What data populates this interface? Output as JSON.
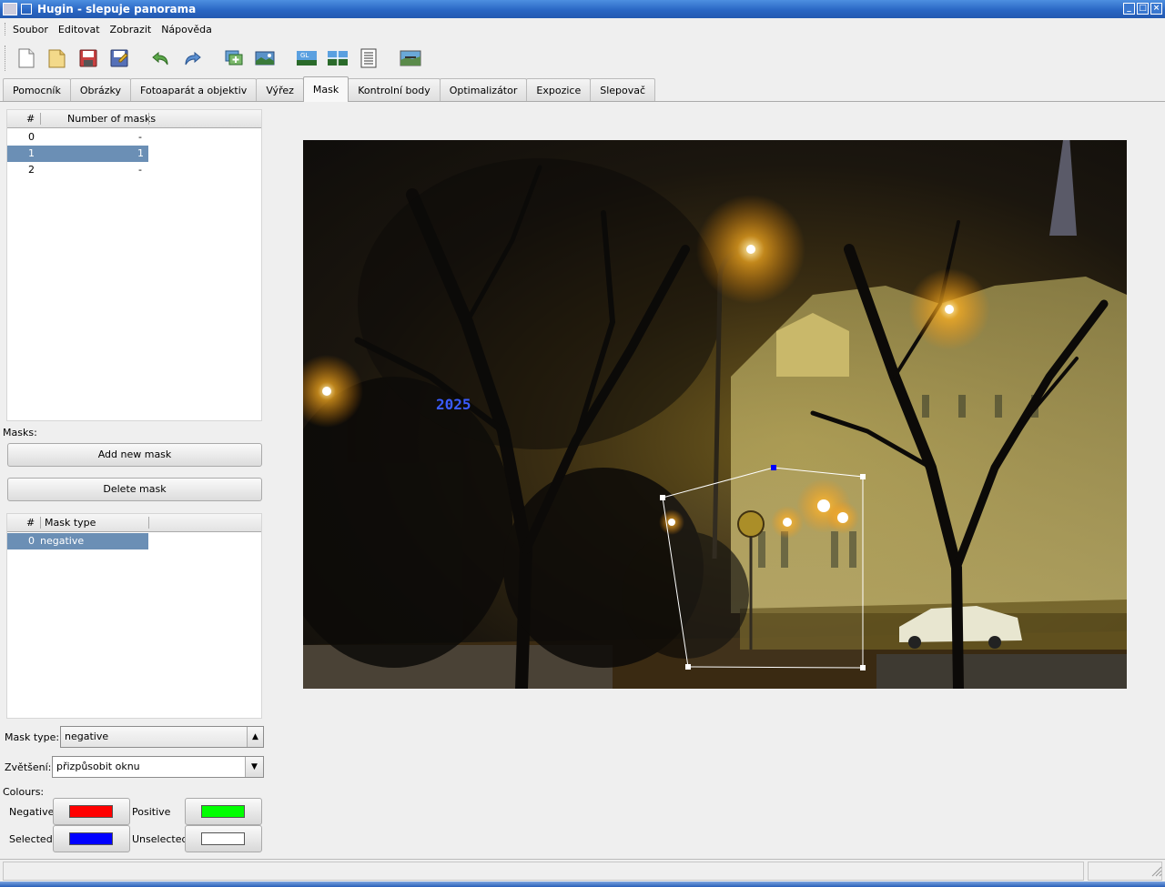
{
  "window": {
    "title": "Hugin - slepuje panorama"
  },
  "menu": {
    "items": [
      "Soubor",
      "Editovat",
      "Zobrazit",
      "Nápověda"
    ]
  },
  "toolbar": {
    "icons": [
      "new-project-icon",
      "open-project-icon",
      "save-icon",
      "save-as-icon",
      "undo-icon",
      "redo-icon",
      "add-images-icon",
      "assistant-icon",
      "gl-preview-icon",
      "fast-preview-icon",
      "properties-icon",
      "panorama-preview-icon"
    ]
  },
  "tabs": [
    {
      "label": "Pomocník",
      "active": false
    },
    {
      "label": "Obrázky",
      "active": false
    },
    {
      "label": "Fotoaparát a objektiv",
      "active": false
    },
    {
      "label": "Výřez",
      "active": false
    },
    {
      "label": "Mask",
      "active": true
    },
    {
      "label": "Kontrolní body",
      "active": false
    },
    {
      "label": "Optimalizátor",
      "active": false
    },
    {
      "label": "Expozice",
      "active": false
    },
    {
      "label": "Slepovač",
      "active": false
    }
  ],
  "images_list": {
    "columns": [
      "#",
      "Number of masks"
    ],
    "rows": [
      {
        "index": "0",
        "count": "-",
        "selected": false
      },
      {
        "index": "1",
        "count": "1",
        "selected": true
      },
      {
        "index": "2",
        "count": "-",
        "selected": false
      }
    ]
  },
  "masks": {
    "label": "Masks:",
    "add_button": "Add new mask",
    "delete_button": "Delete mask",
    "columns": [
      "#",
      "Mask type"
    ],
    "rows": [
      {
        "index": "0",
        "type": "negative",
        "selected": true
      }
    ]
  },
  "mask_type": {
    "label": "Mask type:",
    "value": "negative"
  },
  "zoom": {
    "label": "Zvětšení:",
    "value": "přizpůsobit oknu"
  },
  "colours": {
    "label": "Colours:",
    "negative_label": "Negative",
    "positive_label": "Positive",
    "selected_label": "Selected",
    "unselected_label": "Unselected",
    "negative_color": "#ff0000",
    "positive_color": "#00ff00",
    "selected_color": "#0000ff",
    "unselected_color": "#ffffff"
  },
  "colors": {
    "selection_row": "#6b8fb5",
    "titlebar": "#2a67c4"
  }
}
